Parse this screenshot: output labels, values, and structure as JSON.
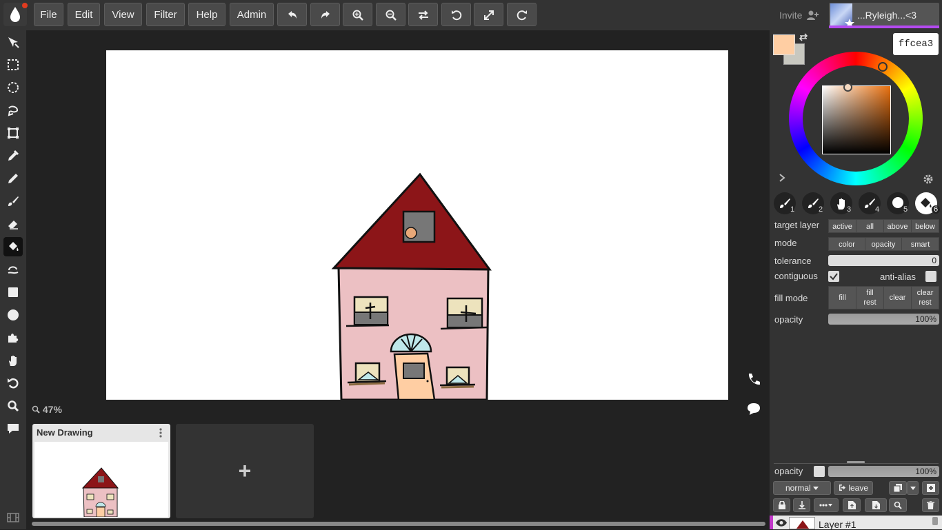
{
  "menu": {
    "file": "File",
    "edit": "Edit",
    "view": "View",
    "filter": "Filter",
    "help": "Help",
    "admin": "Admin"
  },
  "toolbar_icons": [
    "undo-icon",
    "redo-icon",
    "zoom-in-icon",
    "zoom-out-icon",
    "flip-icon",
    "rotate-left-icon",
    "fullscreen-icon",
    "rotate-right-icon"
  ],
  "user": {
    "invite_label": "Invite",
    "name": "...Ryleigh...<3"
  },
  "canvas": {
    "zoom_label": "47%"
  },
  "documents": {
    "current_title": "New Drawing",
    "add_label": "+"
  },
  "color": {
    "primary": "#ffcea3",
    "secondary": "#c8c8c0",
    "hex_value": "ffcea3"
  },
  "brushes": [
    {
      "num": "1"
    },
    {
      "num": "2"
    },
    {
      "num": "3"
    },
    {
      "num": "4"
    },
    {
      "num": "5"
    },
    {
      "num": "6"
    }
  ],
  "fill_options": {
    "target_layer_label": "target layer",
    "target_layer_options": [
      "active",
      "all",
      "above",
      "below"
    ],
    "mode_label": "mode",
    "mode_options": [
      "color",
      "opacity",
      "smart"
    ],
    "tolerance_label": "tolerance",
    "tolerance_value": "0",
    "contiguous_label": "contiguous",
    "contiguous_checked": true,
    "antialias_label": "anti-alias",
    "antialias_checked": false,
    "fill_mode_label": "fill mode",
    "fill_mode_options": [
      {
        "line1": "fill",
        "line2": ""
      },
      {
        "line1": "fill",
        "line2": "rest"
      },
      {
        "line1": "clear",
        "line2": ""
      },
      {
        "line1": "clear",
        "line2": "rest"
      }
    ],
    "opacity_label": "opacity",
    "opacity_value": "100%"
  },
  "layers": {
    "opacity_label": "opacity",
    "opacity_value": "100%",
    "blend_mode": "normal",
    "leave_label": "leave",
    "layer_name": "Layer #1"
  }
}
